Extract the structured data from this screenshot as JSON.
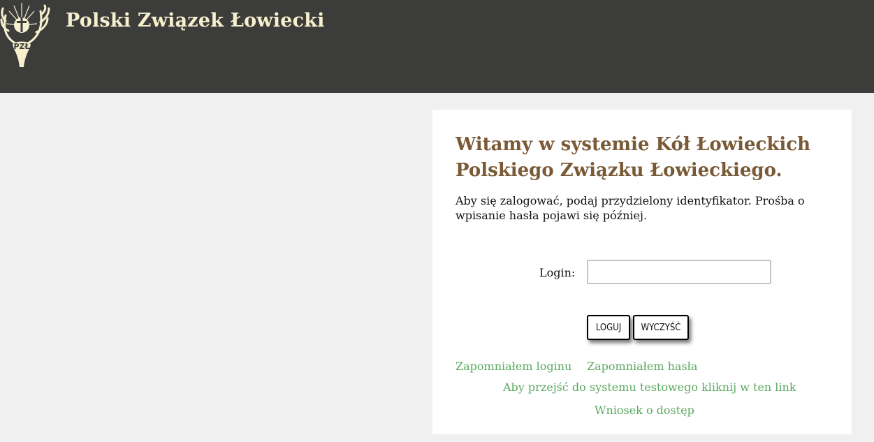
{
  "header": {
    "logo_text": "PZŁ",
    "title": "Polski Związek Łowiecki"
  },
  "panel": {
    "welcome": "Witamy w systemie Kół Łowieckich Polskiego Związku Łowieckiego.",
    "intro": "Aby się zalogować, podaj przydzielony identyfikator. Prośba o wpisanie hasła pojawi się później.",
    "login_label": "Login:",
    "login_value": "",
    "login_button": "LOGUJ",
    "clear_button": "WYCZYŚĆ",
    "forgot_login": "Zapomniałem loginu",
    "forgot_password": "Zapomniałem hasła",
    "test_system_link": "Aby przejść do systemu testowego kliknij w ten link",
    "access_request": "Wniosek o dostęp"
  },
  "colors": {
    "header_bg": "#3c3d3b",
    "brand_text": "#f7f0cf",
    "heading": "#7a5a36",
    "link": "#5aa95f",
    "page_bg": "#f0f0f0"
  }
}
